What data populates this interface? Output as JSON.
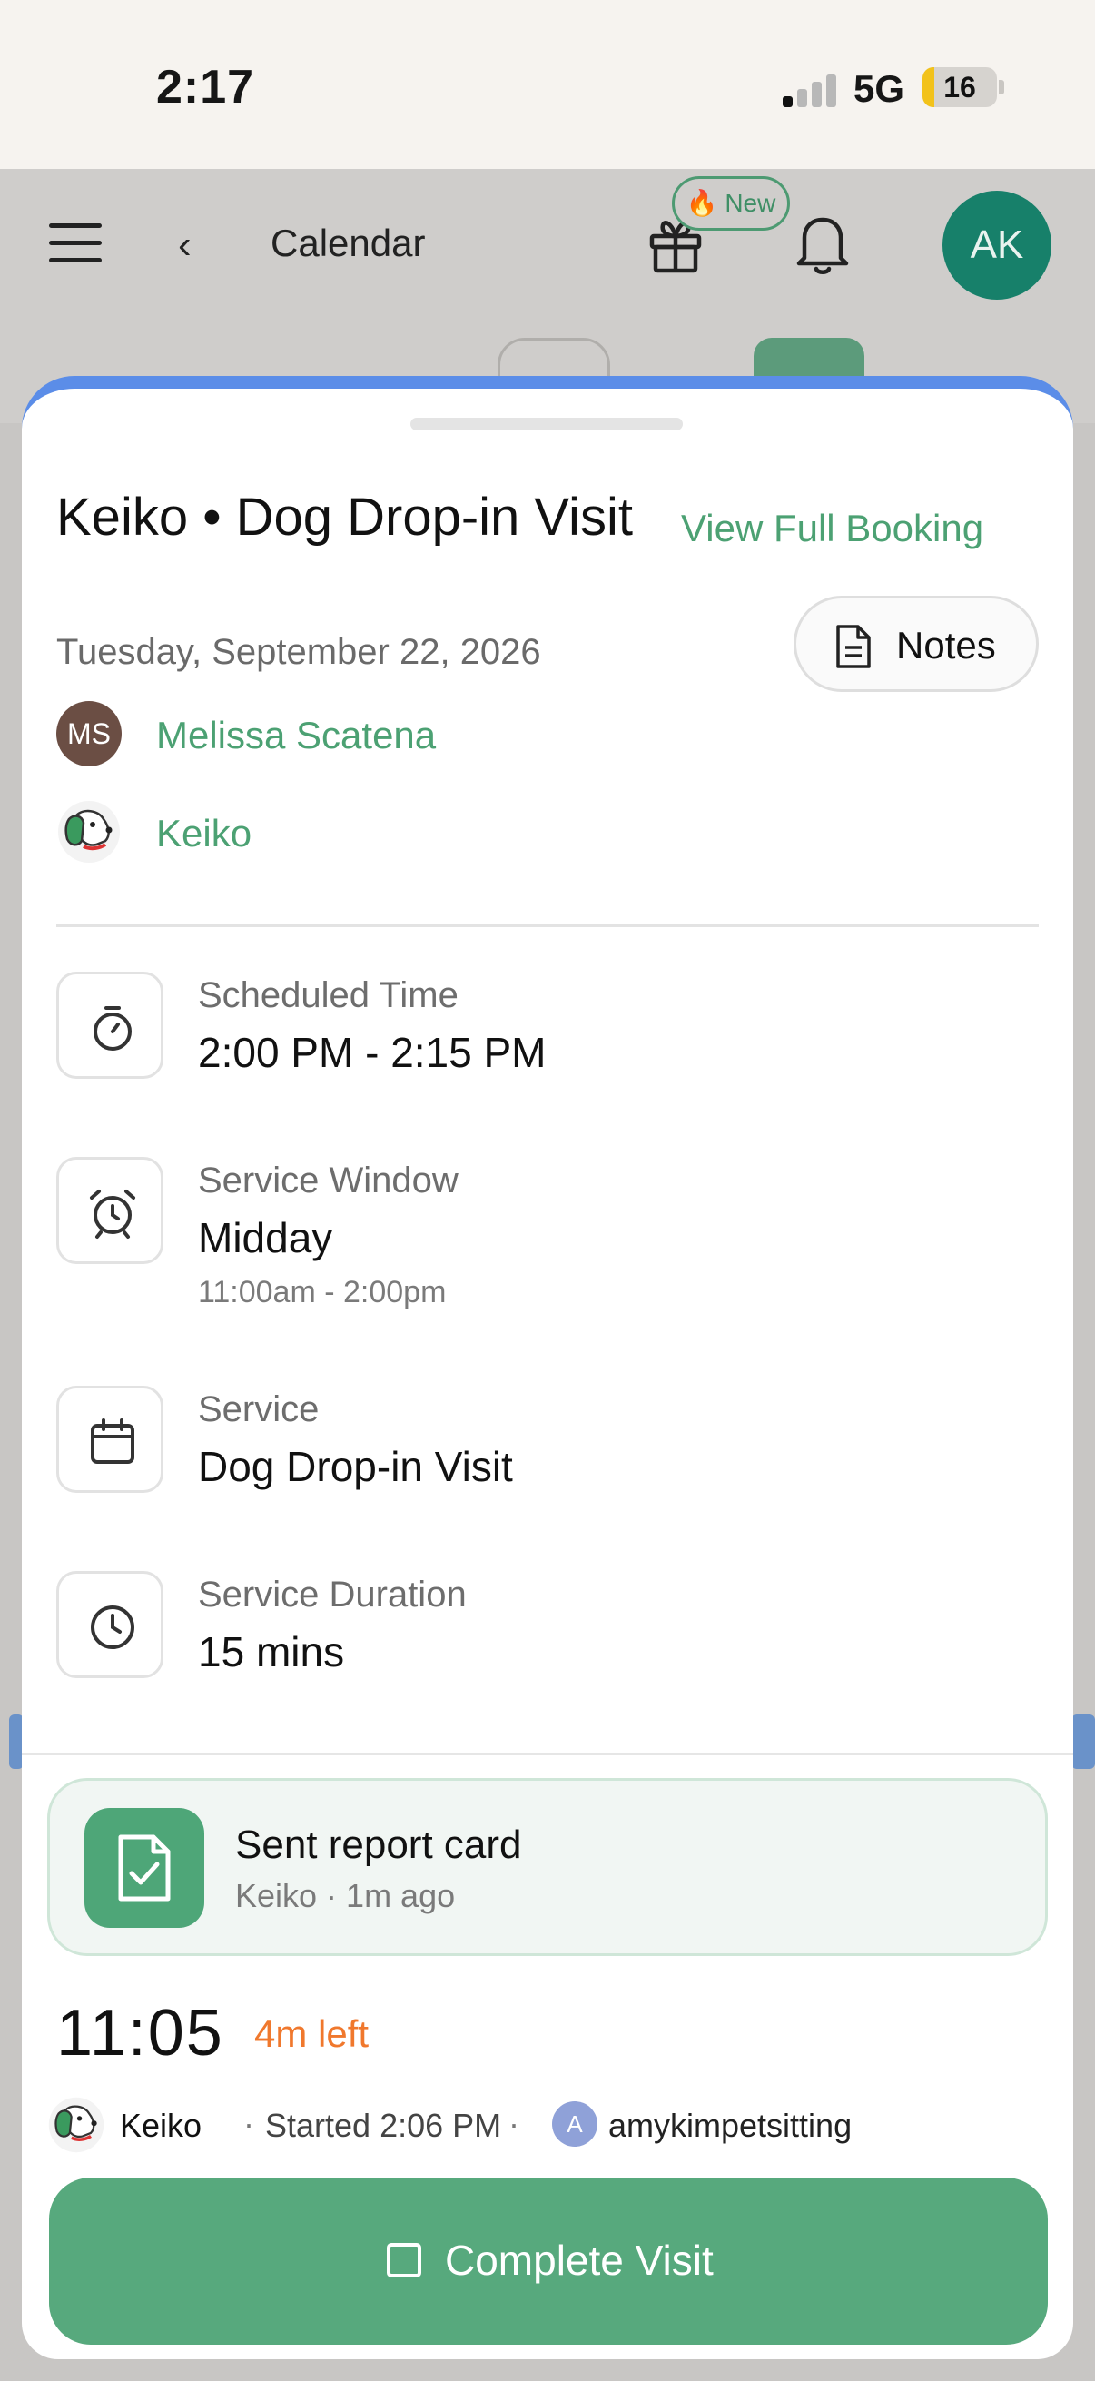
{
  "status_bar": {
    "time": "2:17",
    "network": "5G",
    "battery": "16",
    "battery_level": 0.16
  },
  "app_header": {
    "title": "Calendar",
    "new_badge": "🔥 New",
    "avatar_initials": "AK"
  },
  "sheet": {
    "title": "Keiko • Dog Drop-in Visit",
    "view_full_booking": "View Full Booking",
    "notes_label": "Notes",
    "date": "Tuesday, September 22, 2026",
    "client": {
      "initials": "MS",
      "name": "Melissa Scatena"
    },
    "pet": {
      "name": "Keiko"
    },
    "details": [
      {
        "label": "Scheduled Time",
        "value": "2:00 PM - 2:15 PM",
        "icon": "stopwatch-icon"
      },
      {
        "label": "Service Window",
        "value": "Midday",
        "sub": "11:00am - 2:00pm",
        "icon": "alarm-clock-icon"
      },
      {
        "label": "Service",
        "value": "Dog Drop-in Visit",
        "icon": "calendar-icon"
      },
      {
        "label": "Service Duration",
        "value": "15 mins",
        "icon": "clock-icon"
      }
    ],
    "report_card": {
      "title": "Sent report card",
      "subtitle": "Keiko · 1m ago",
      "icon": "report-check-icon"
    },
    "visit": {
      "timer": "11:05",
      "time_left": "4m left",
      "pet_name": "Keiko",
      "separator": "·",
      "started": "Started 2:06 PM",
      "user_initial": "A",
      "user_name": "amykimpetsitting"
    },
    "complete_button": "Complete Visit"
  },
  "colors": {
    "accent_green": "#4ca173",
    "button_green": "#57a97d",
    "sheet_top_border": "#5b8de8",
    "time_left": "#f0782d",
    "avatar_teal": "#17806a"
  }
}
